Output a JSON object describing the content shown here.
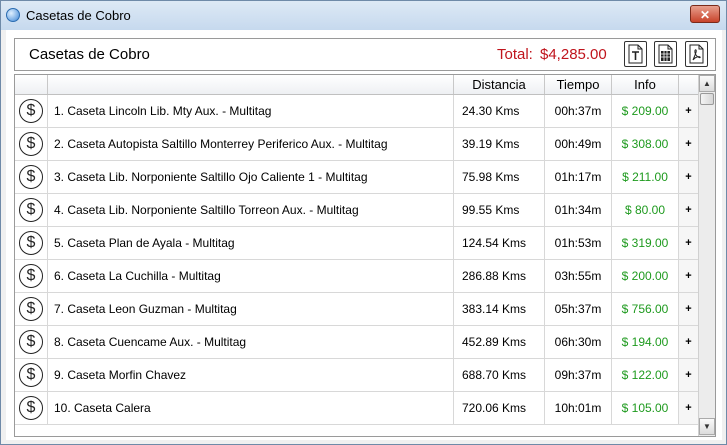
{
  "window": {
    "title": "Casetas de Cobro",
    "close_label": "✕"
  },
  "header": {
    "title": "Casetas de Cobro",
    "total_label": "Total:",
    "total_value": "$4,285.00",
    "export_buttons": [
      {
        "name": "export-text-button",
        "icon": "text-file-icon"
      },
      {
        "name": "export-excel-button",
        "icon": "spreadsheet-icon"
      },
      {
        "name": "export-pdf-button",
        "icon": "pdf-icon"
      }
    ]
  },
  "table": {
    "columns": {
      "icon": "",
      "name": "",
      "distance": "Distancia",
      "time": "Tiempo",
      "info": "Info"
    },
    "rows": [
      {
        "name": "1. Caseta Lincoln Lib. Mty Aux. - Multitag",
        "distance": "24.30 Kms",
        "time": "00h:37m",
        "cost": "$ 209.00",
        "action": "+"
      },
      {
        "name": "2. Caseta Autopista Saltillo Monterrey Periferico Aux. - Multitag",
        "distance": "39.19 Kms",
        "time": "00h:49m",
        "cost": "$ 308.00",
        "action": "+"
      },
      {
        "name": "3. Caseta Lib. Norponiente Saltillo Ojo Caliente 1 - Multitag",
        "distance": "75.98 Kms",
        "time": "01h:17m",
        "cost": "$ 211.00",
        "action": "+"
      },
      {
        "name": "4. Caseta Lib. Norponiente Saltillo Torreon Aux. - Multitag",
        "distance": "99.55 Kms",
        "time": "01h:34m",
        "cost": "$ 80.00",
        "action": "+"
      },
      {
        "name": "5. Caseta Plan de Ayala - Multitag",
        "distance": "124.54 Kms",
        "time": "01h:53m",
        "cost": "$ 319.00",
        "action": "+"
      },
      {
        "name": "6. Caseta La Cuchilla - Multitag",
        "distance": "286.88 Kms",
        "time": "03h:55m",
        "cost": "$ 200.00",
        "action": "+"
      },
      {
        "name": "7. Caseta Leon Guzman - Multitag",
        "distance": "383.14 Kms",
        "time": "05h:37m",
        "cost": "$ 756.00",
        "action": "+"
      },
      {
        "name": "8. Caseta Cuencame Aux. - Multitag",
        "distance": "452.89 Kms",
        "time": "06h:30m",
        "cost": "$ 194.00",
        "action": "+"
      },
      {
        "name": "9. Caseta Morfin Chavez",
        "distance": "688.70 Kms",
        "time": "09h:37m",
        "cost": "$ 122.00",
        "action": "+"
      },
      {
        "name": "10. Caseta Calera",
        "distance": "720.06 Kms",
        "time": "10h:01m",
        "cost": "$ 105.00",
        "action": "+"
      }
    ],
    "row_icon": "dollar-circle-icon",
    "row_icon_glyph": "$"
  },
  "scrollbar": {
    "up": "▲",
    "down": "▼"
  },
  "colors": {
    "total": "#c0141c",
    "cost": "#1e9a1e"
  }
}
